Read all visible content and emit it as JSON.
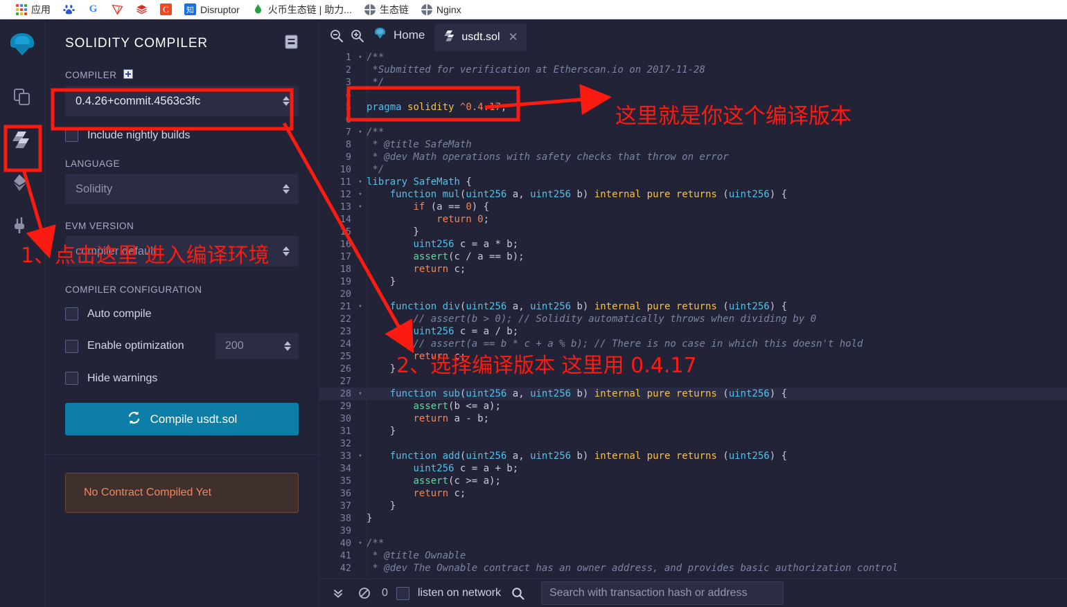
{
  "browser": {
    "bookmarks": [
      {
        "icon": "apps-grid-icon",
        "label": "应用"
      },
      {
        "icon": "baidu-icon",
        "label": ""
      },
      {
        "icon": "google-icon",
        "label": ""
      },
      {
        "icon": "tron-icon",
        "label": ""
      },
      {
        "icon": "book-icon",
        "label": ""
      },
      {
        "icon": "c-icon",
        "label": ""
      },
      {
        "icon": "zhihu-icon",
        "label": "Disruptor"
      },
      {
        "icon": "flame-icon",
        "label": "火币生态链 | 助力..."
      },
      {
        "icon": "globe-icon",
        "label": "生态链"
      },
      {
        "icon": "globe-icon",
        "label": "Nginx"
      }
    ]
  },
  "rail": {
    "logo": "remix-logo-icon",
    "items": [
      {
        "icon": "file-explorer-icon",
        "name": "file-explorer",
        "active": false
      },
      {
        "icon": "solidity-compiler-icon",
        "name": "solidity-compiler",
        "active": true
      },
      {
        "icon": "deploy-run-icon",
        "name": "deploy-and-run",
        "active": false
      },
      {
        "icon": "plugin-manager-icon",
        "name": "plugin-manager",
        "active": false
      }
    ]
  },
  "panel": {
    "title": "SOLIDITY COMPILER",
    "doc_icon": "document-icon",
    "compiler_label": "COMPILER",
    "compiler_add_icon": "add-icon",
    "compiler_version": "0.4.26+commit.4563c3fc",
    "nightly_label": "Include nightly builds",
    "language_label": "LANGUAGE",
    "language_value": "Solidity",
    "evm_label": "EVM VERSION",
    "evm_value": "compiler default",
    "config_label": "COMPILER CONFIGURATION",
    "auto_compile_label": "Auto compile",
    "enable_optimization_label": "Enable optimization",
    "optimization_runs": "200",
    "hide_warnings_label": "Hide warnings",
    "compile_button": "Compile usdt.sol",
    "compile_icon": "refresh-icon",
    "compile_button_color": "#0c7ea8",
    "no_contract_message": "No Contract Compiled Yet",
    "no_contract_color": "#f0875a"
  },
  "editor": {
    "zoom_out_icon": "zoom-out-icon",
    "zoom_in_icon": "zoom-in-icon",
    "home_icon": "remix-home-icon",
    "home_label": "Home",
    "tab_icon": "solidity-file-icon",
    "tab_name": "usdt.sol",
    "tab_close_icon": "close-icon",
    "active_line": 28,
    "lines": [
      {
        "n": 1,
        "fold": true,
        "code": "/**"
      },
      {
        "n": 2,
        "fold": false,
        "code": " *Submitted for verification at Etherscan.io on 2017-11-28"
      },
      {
        "n": 3,
        "fold": false,
        "code": " */"
      },
      {
        "n": 4,
        "fold": false,
        "code": ""
      },
      {
        "n": 5,
        "fold": false,
        "code": "pragma solidity ^0.4.17;"
      },
      {
        "n": 6,
        "fold": false,
        "code": ""
      },
      {
        "n": 7,
        "fold": true,
        "code": "/**"
      },
      {
        "n": 8,
        "fold": false,
        "code": " * @title SafeMath"
      },
      {
        "n": 9,
        "fold": false,
        "code": " * @dev Math operations with safety checks that throw on error"
      },
      {
        "n": 10,
        "fold": false,
        "code": " */"
      },
      {
        "n": 11,
        "fold": true,
        "code": "library SafeMath {"
      },
      {
        "n": 12,
        "fold": true,
        "code": "    function mul(uint256 a, uint256 b) internal pure returns (uint256) {"
      },
      {
        "n": 13,
        "fold": true,
        "code": "        if (a == 0) {"
      },
      {
        "n": 14,
        "fold": false,
        "code": "            return 0;"
      },
      {
        "n": 15,
        "fold": false,
        "code": "        }"
      },
      {
        "n": 16,
        "fold": false,
        "code": "        uint256 c = a * b;"
      },
      {
        "n": 17,
        "fold": false,
        "code": "        assert(c / a == b);"
      },
      {
        "n": 18,
        "fold": false,
        "code": "        return c;"
      },
      {
        "n": 19,
        "fold": false,
        "code": "    }"
      },
      {
        "n": 20,
        "fold": false,
        "code": ""
      },
      {
        "n": 21,
        "fold": true,
        "code": "    function div(uint256 a, uint256 b) internal pure returns (uint256) {"
      },
      {
        "n": 22,
        "fold": false,
        "code": "        // assert(b > 0); // Solidity automatically throws when dividing by 0"
      },
      {
        "n": 23,
        "fold": false,
        "code": "        uint256 c = a / b;"
      },
      {
        "n": 24,
        "fold": false,
        "code": "        // assert(a == b * c + a % b); // There is no case in which this doesn't hold"
      },
      {
        "n": 25,
        "fold": false,
        "code": "        return c;"
      },
      {
        "n": 26,
        "fold": false,
        "code": "    }"
      },
      {
        "n": 27,
        "fold": false,
        "code": ""
      },
      {
        "n": 28,
        "fold": true,
        "code": "    function sub(uint256 a, uint256 b) internal pure returns (uint256) {"
      },
      {
        "n": 29,
        "fold": false,
        "code": "        assert(b <= a);"
      },
      {
        "n": 30,
        "fold": false,
        "code": "        return a - b;"
      },
      {
        "n": 31,
        "fold": false,
        "code": "    }"
      },
      {
        "n": 32,
        "fold": false,
        "code": ""
      },
      {
        "n": 33,
        "fold": true,
        "code": "    function add(uint256 a, uint256 b) internal pure returns (uint256) {"
      },
      {
        "n": 34,
        "fold": false,
        "code": "        uint256 c = a + b;"
      },
      {
        "n": 35,
        "fold": false,
        "code": "        assert(c >= a);"
      },
      {
        "n": 36,
        "fold": false,
        "code": "        return c;"
      },
      {
        "n": 37,
        "fold": false,
        "code": "    }"
      },
      {
        "n": 38,
        "fold": false,
        "code": "}"
      },
      {
        "n": 39,
        "fold": false,
        "code": ""
      },
      {
        "n": 40,
        "fold": true,
        "code": "/**"
      },
      {
        "n": 41,
        "fold": false,
        "code": " * @title Ownable"
      },
      {
        "n": 42,
        "fold": false,
        "code": " * @dev The Ownable contract has an owner address, and provides basic authorization control"
      }
    ]
  },
  "statusbar": {
    "collapse_icon": "double-chevron-down-icon",
    "clear_icon": "ban-icon",
    "count": "0",
    "listen_label": "listen on network",
    "search_icon": "search-icon",
    "search_placeholder": "Search with transaction hash or address"
  },
  "annotations": {
    "color": "#fb1b10",
    "step1": "1、点击这里 进入编译环境",
    "step2": "2、选择编译版本  这里用 0.4.17",
    "note_version": "这里就是你这个编译版本"
  }
}
